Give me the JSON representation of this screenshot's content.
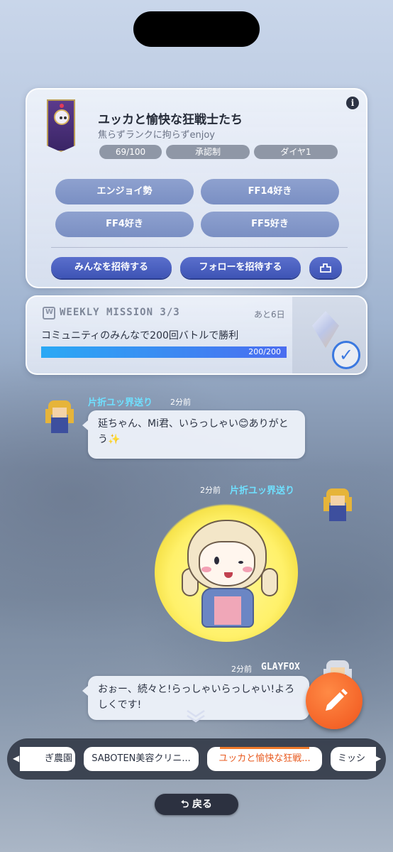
{
  "community": {
    "name": "ユッカと愉快な狂戦士たち",
    "description": "焦らずランクに拘らずenjoy",
    "badges": [
      "69/100",
      "承認制",
      "ダイヤ1"
    ],
    "tags": [
      "エンジョイ勢",
      "FF14好き",
      "FF4好き",
      "FF5好き"
    ],
    "invite_all_label": "みんなを招待する",
    "invite_follow_label": "フォローを招待する"
  },
  "mission": {
    "title": "WEEKLY MISSION 3/3",
    "remaining": "あと6日",
    "text": "コミュニティのみんなで200回バトルで勝利",
    "progress_text": "200/200",
    "progress_fraction": 1.0
  },
  "chat": [
    {
      "name": "片折ユッ界送り",
      "time": "2分前",
      "text": "延ちゃん、Mi君、いらっしゃい😊ありがとう✨"
    },
    {
      "name": "片折ユッ界送り",
      "time": "2分前",
      "type": "sticker"
    },
    {
      "name": "GLAYFOX",
      "time": "2分前",
      "text": "おぉー、続々と!らっしゃいらっしゃい!よろしくです!"
    }
  ],
  "tabs": [
    "ぎ農園",
    "SABOTEN美容クリニ...",
    "ユッカと愉快な狂戦...",
    "ミッシ"
  ],
  "active_tab": 2,
  "back_label": "戻る",
  "colors": {
    "accent": "#f0541c",
    "name_color": "#6fe0ff",
    "button_blue": "#3e54b5"
  },
  "icons": [
    "info-icon",
    "calendar-icon",
    "share-icon",
    "check-icon",
    "pencil-icon",
    "back-arrow-icon"
  ]
}
